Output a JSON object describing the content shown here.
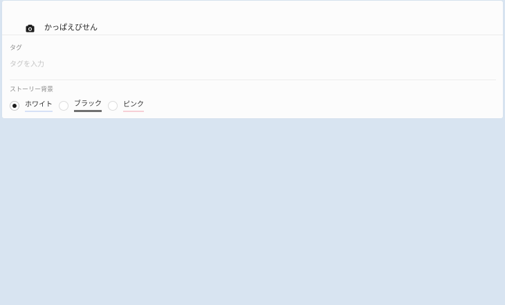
{
  "cover": {
    "icon": "camera-icon",
    "title": "かっぱえびせん"
  },
  "tags": {
    "label": "タグ",
    "placeholder": "タグを入力",
    "value": ""
  },
  "story_background": {
    "label": "ストーリー背景",
    "selected": "ホワイト",
    "options": [
      {
        "label": "ホワイト",
        "color": "#d6e1f6",
        "checked": true
      },
      {
        "label": "ブラック",
        "color": "#6f6f6f",
        "checked": false
      },
      {
        "label": "ピンク",
        "color": "#f6cfd6",
        "checked": false
      }
    ]
  },
  "colors": {
    "page_background": "#d8e4f1",
    "card_background": "#fcfcfc"
  }
}
